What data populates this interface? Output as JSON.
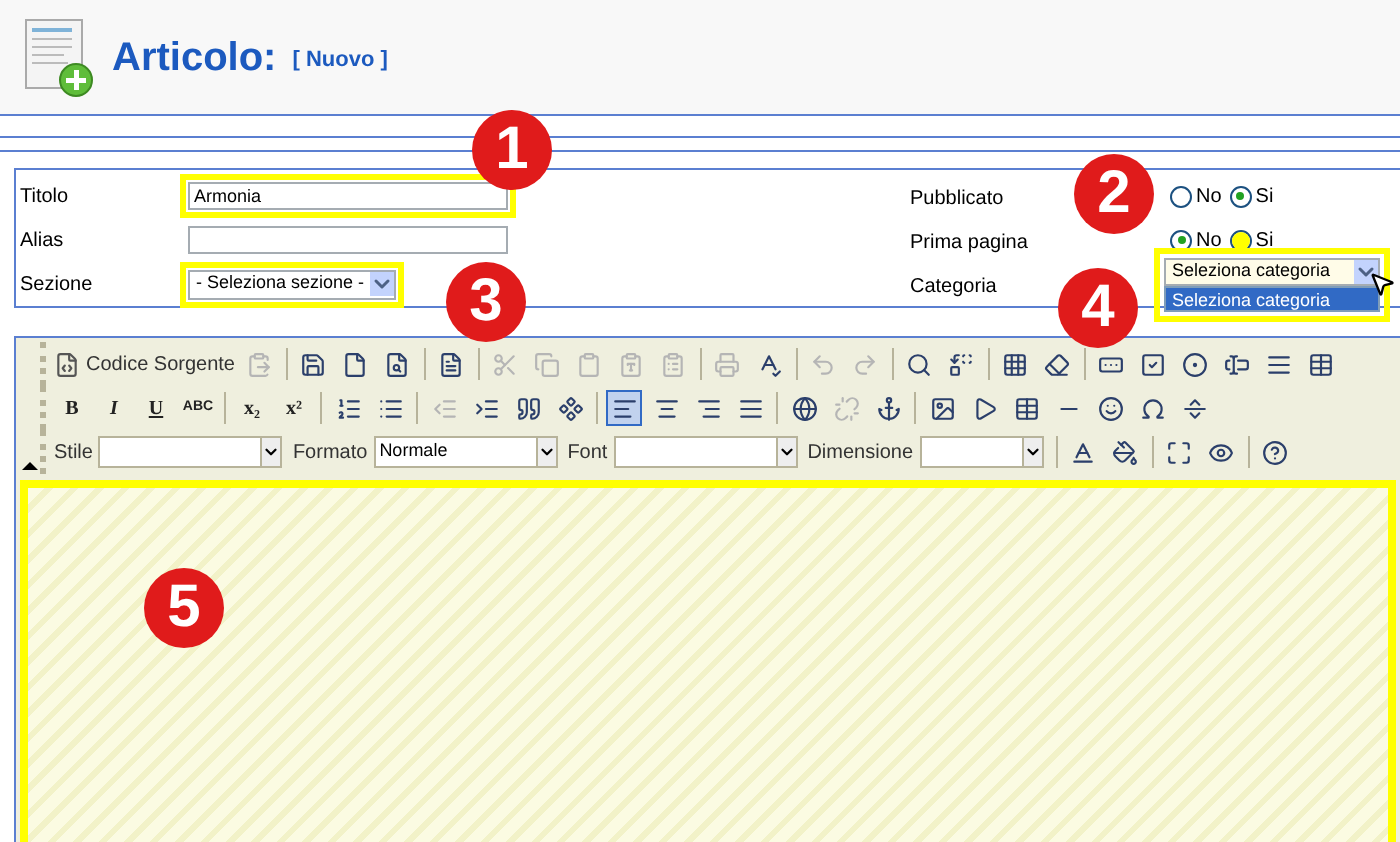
{
  "header": {
    "title": "Articolo:",
    "subtitle": "[ Nuovo ]"
  },
  "form": {
    "left": [
      {
        "label": "Titolo",
        "kind": "text",
        "value": "Armonia",
        "highlighted": true
      },
      {
        "label": "Alias",
        "kind": "text",
        "highlighted": false
      },
      {
        "label": "Sezione",
        "kind": "select",
        "value": "- Seleziona sezione -",
        "highlighted": true
      }
    ],
    "right": [
      {
        "label": "Pubblicato",
        "kind": "radio",
        "options": [
          {
            "label": "No",
            "selected": false,
            "highlighted": false
          },
          {
            "label": "Si",
            "selected": true,
            "highlighted": false
          }
        ]
      },
      {
        "label": "Prima pagina",
        "kind": "radio",
        "options": [
          {
            "label": "No",
            "selected": true,
            "highlighted": false
          },
          {
            "label": "Si",
            "selected": false,
            "highlighted": true
          }
        ]
      },
      {
        "label": "Categoria",
        "kind": "select",
        "value": "Seleziona categoria",
        "highlighted": true,
        "open_options": [
          {
            "label": "Seleziona categoria",
            "selected": true
          }
        ]
      }
    ]
  },
  "toolbar": {
    "rows": [
      [
        {
          "kind": "button",
          "label": "Codice Sorgente"
        },
        {
          "kind": "icon",
          "disabled": true
        },
        {
          "kind": "sep"
        },
        {
          "kind": "icon",
          "disabled": false
        },
        {
          "kind": "icon",
          "disabled": false
        },
        {
          "kind": "icon",
          "disabled": false
        },
        {
          "kind": "sep"
        },
        {
          "kind": "icon",
          "disabled": false
        },
        {
          "kind": "sep"
        },
        {
          "kind": "icon",
          "disabled": true
        },
        {
          "kind": "icon",
          "disabled": true
        },
        {
          "kind": "icon",
          "disabled": true
        },
        {
          "kind": "icon",
          "disabled": true
        },
        {
          "kind": "icon",
          "disabled": true
        },
        {
          "kind": "sep"
        },
        {
          "kind": "icon",
          "disabled": true
        },
        {
          "kind": "icon",
          "disabled": false
        },
        {
          "kind": "sep"
        },
        {
          "kind": "icon",
          "disabled": true
        },
        {
          "kind": "icon",
          "disabled": true
        },
        {
          "kind": "sep"
        },
        {
          "kind": "icon",
          "disabled": false
        },
        {
          "kind": "icon",
          "disabled": false
        },
        {
          "kind": "sep"
        },
        {
          "kind": "icon",
          "disabled": false
        },
        {
          "kind": "icon",
          "disabled": false
        },
        {
          "kind": "sep"
        },
        {
          "kind": "icon",
          "disabled": false
        },
        {
          "kind": "icon",
          "disabled": false
        },
        {
          "kind": "icon",
          "disabled": false
        },
        {
          "kind": "icon",
          "disabled": false
        },
        {
          "kind": "icon",
          "disabled": false
        },
        {
          "kind": "icon",
          "disabled": false
        }
      ],
      [
        {
          "kind": "glyph",
          "label": "B"
        },
        {
          "kind": "glyph",
          "label": "I"
        },
        {
          "kind": "glyph",
          "label": "U"
        },
        {
          "kind": "glyph",
          "label": "ABC"
        },
        {
          "kind": "sep"
        },
        {
          "kind": "glyph",
          "label": "x₂"
        },
        {
          "kind": "glyph",
          "label": "x²"
        },
        {
          "kind": "sep"
        },
        {
          "kind": "icon",
          "disabled": false
        },
        {
          "kind": "icon",
          "disabled": false
        },
        {
          "kind": "sep"
        },
        {
          "kind": "icon",
          "disabled": true
        },
        {
          "kind": "icon",
          "disabled": false
        },
        {
          "kind": "icon",
          "disabled": false
        },
        {
          "kind": "icon",
          "disabled": false
        },
        {
          "kind": "sep"
        },
        {
          "kind": "icon",
          "disabled": false,
          "active": true
        },
        {
          "kind": "icon",
          "disabled": false
        },
        {
          "kind": "icon",
          "disabled": false
        },
        {
          "kind": "icon",
          "disabled": false
        },
        {
          "kind": "sep"
        },
        {
          "kind": "icon",
          "disabled": false
        },
        {
          "kind": "icon",
          "disabled": true
        },
        {
          "kind": "icon",
          "disabled": false
        },
        {
          "kind": "sep"
        },
        {
          "kind": "icon",
          "disabled": false
        },
        {
          "kind": "icon",
          "disabled": false
        },
        {
          "kind": "icon",
          "disabled": false
        },
        {
          "kind": "icon",
          "disabled": false
        },
        {
          "kind": "icon",
          "disabled": false
        },
        {
          "kind": "icon",
          "disabled": false
        },
        {
          "kind": "icon",
          "disabled": false
        }
      ],
      [
        {
          "kind": "combo",
          "label": "Stile"
        },
        {
          "kind": "combo",
          "label": "Formato",
          "value": "Normale"
        },
        {
          "kind": "combo",
          "label": "Font"
        },
        {
          "kind": "combo",
          "label": "Dimensione"
        },
        {
          "kind": "sep"
        },
        {
          "kind": "icon",
          "disabled": false
        },
        {
          "kind": "icon",
          "disabled": false
        },
        {
          "kind": "sep"
        },
        {
          "kind": "icon",
          "disabled": false
        },
        {
          "kind": "icon",
          "disabled": false
        },
        {
          "kind": "sep"
        },
        {
          "kind": "icon",
          "disabled": false
        }
      ]
    ]
  },
  "editor": {
    "highlighted": true
  },
  "callouts": [
    "1",
    "2",
    "3",
    "4",
    "5"
  ]
}
